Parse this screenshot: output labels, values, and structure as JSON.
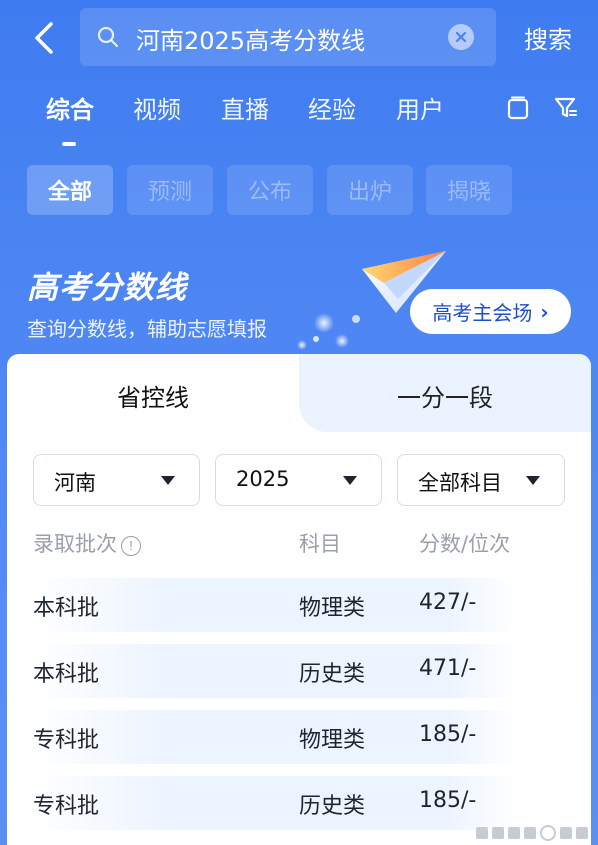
{
  "search": {
    "query": "河南2025高考分数线",
    "action_label": "搜索"
  },
  "tabs": [
    {
      "label": "综合",
      "active": true
    },
    {
      "label": "视频"
    },
    {
      "label": "直播"
    },
    {
      "label": "经验"
    },
    {
      "label": "用户"
    }
  ],
  "chips": [
    {
      "label": "全部",
      "active": true
    },
    {
      "label": "预测"
    },
    {
      "label": "公布"
    },
    {
      "label": "出炉"
    },
    {
      "label": "揭晓"
    }
  ],
  "hero": {
    "title": "高考分数线",
    "subtitle": "查询分数线，辅助志愿填报",
    "button_label": "高考主会场",
    "button_chevron": "›"
  },
  "card": {
    "segments": [
      {
        "label": "省控线",
        "active": true
      },
      {
        "label": "一分一段"
      }
    ],
    "filters": {
      "province": "河南",
      "year": "2025",
      "subject": "全部科目"
    },
    "table": {
      "headers": [
        "录取批次",
        "科目",
        "分数/位次"
      ],
      "rows": [
        {
          "batch": "本科批",
          "subject": "物理类",
          "score": "427/-"
        },
        {
          "batch": "本科批",
          "subject": "历史类",
          "score": "471/-"
        },
        {
          "batch": "专科批",
          "subject": "物理类",
          "score": "185/-"
        },
        {
          "batch": "专科批",
          "subject": "历史类",
          "score": "185/-"
        }
      ]
    }
  },
  "colors": {
    "background": "#4a84f3",
    "accent_blue": "#1f4fc7",
    "muted_text": "#9aa0aa",
    "row_highlight": "#ebf3ff"
  },
  "icons": {
    "back": "chevron-left-icon",
    "search": "search-icon",
    "clear": "clear-icon",
    "copy": "copy-icon",
    "filter": "filter-icon",
    "info": "info-icon"
  }
}
